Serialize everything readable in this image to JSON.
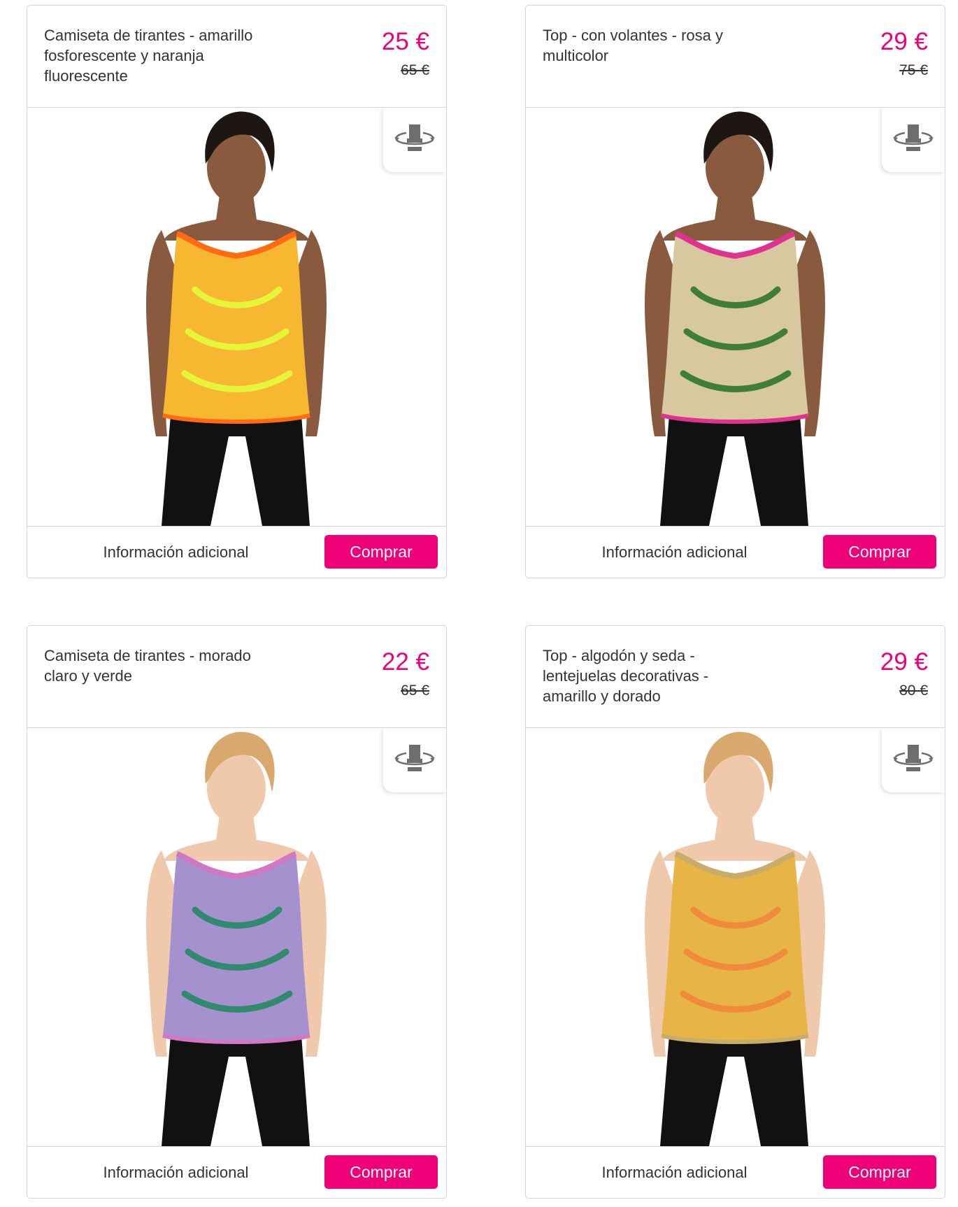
{
  "products": [
    {
      "title": "Camiseta de tirantes - amarillo fosforescente y naranja fluorescente",
      "price": "25 €",
      "old_price": "65 €",
      "info_label": "Información adicional",
      "buy_label": "Comprar",
      "image": "model-orange-tank-top",
      "colors": {
        "top": "#f7b731",
        "accent": "#ff6a13",
        "pattern": "#e4f53a",
        "hair": "#1d1612",
        "skin": "#8a5a3f"
      }
    },
    {
      "title": "Top - con volantes - rosa y multicolor",
      "price": "29 €",
      "old_price": "75 €",
      "info_label": "Información adicional",
      "buy_label": "Comprar",
      "image": "model-multicolor-ruffle-top",
      "colors": {
        "top": "#d8c8a0",
        "accent": "#e0338f",
        "pattern": "#3e7d3a",
        "hair": "#1d1612",
        "skin": "#8a5a3f"
      }
    },
    {
      "title": "Camiseta de tirantes - morado claro y verde",
      "price": "22 €",
      "old_price": "65 €",
      "info_label": "Información adicional",
      "buy_label": "Comprar",
      "image": "model-purple-green-tank-top",
      "colors": {
        "top": "#a691cf",
        "accent": "#d277c4",
        "pattern": "#2f8a6e",
        "hair": "#d9a86c",
        "skin": "#f0c9ad"
      }
    },
    {
      "title": "Top - algodón y seda - lentejuelas decorativas - amarillo y dorado",
      "price": "29 €",
      "old_price": "80 €",
      "info_label": "Información adicional",
      "buy_label": "Comprar",
      "image": "model-yellow-gold-sequin-top",
      "colors": {
        "top": "#e7b546",
        "accent": "#c9ab6a",
        "pattern": "#f08a3c",
        "hair": "#d9a86c",
        "skin": "#f0c9ad"
      }
    }
  ]
}
